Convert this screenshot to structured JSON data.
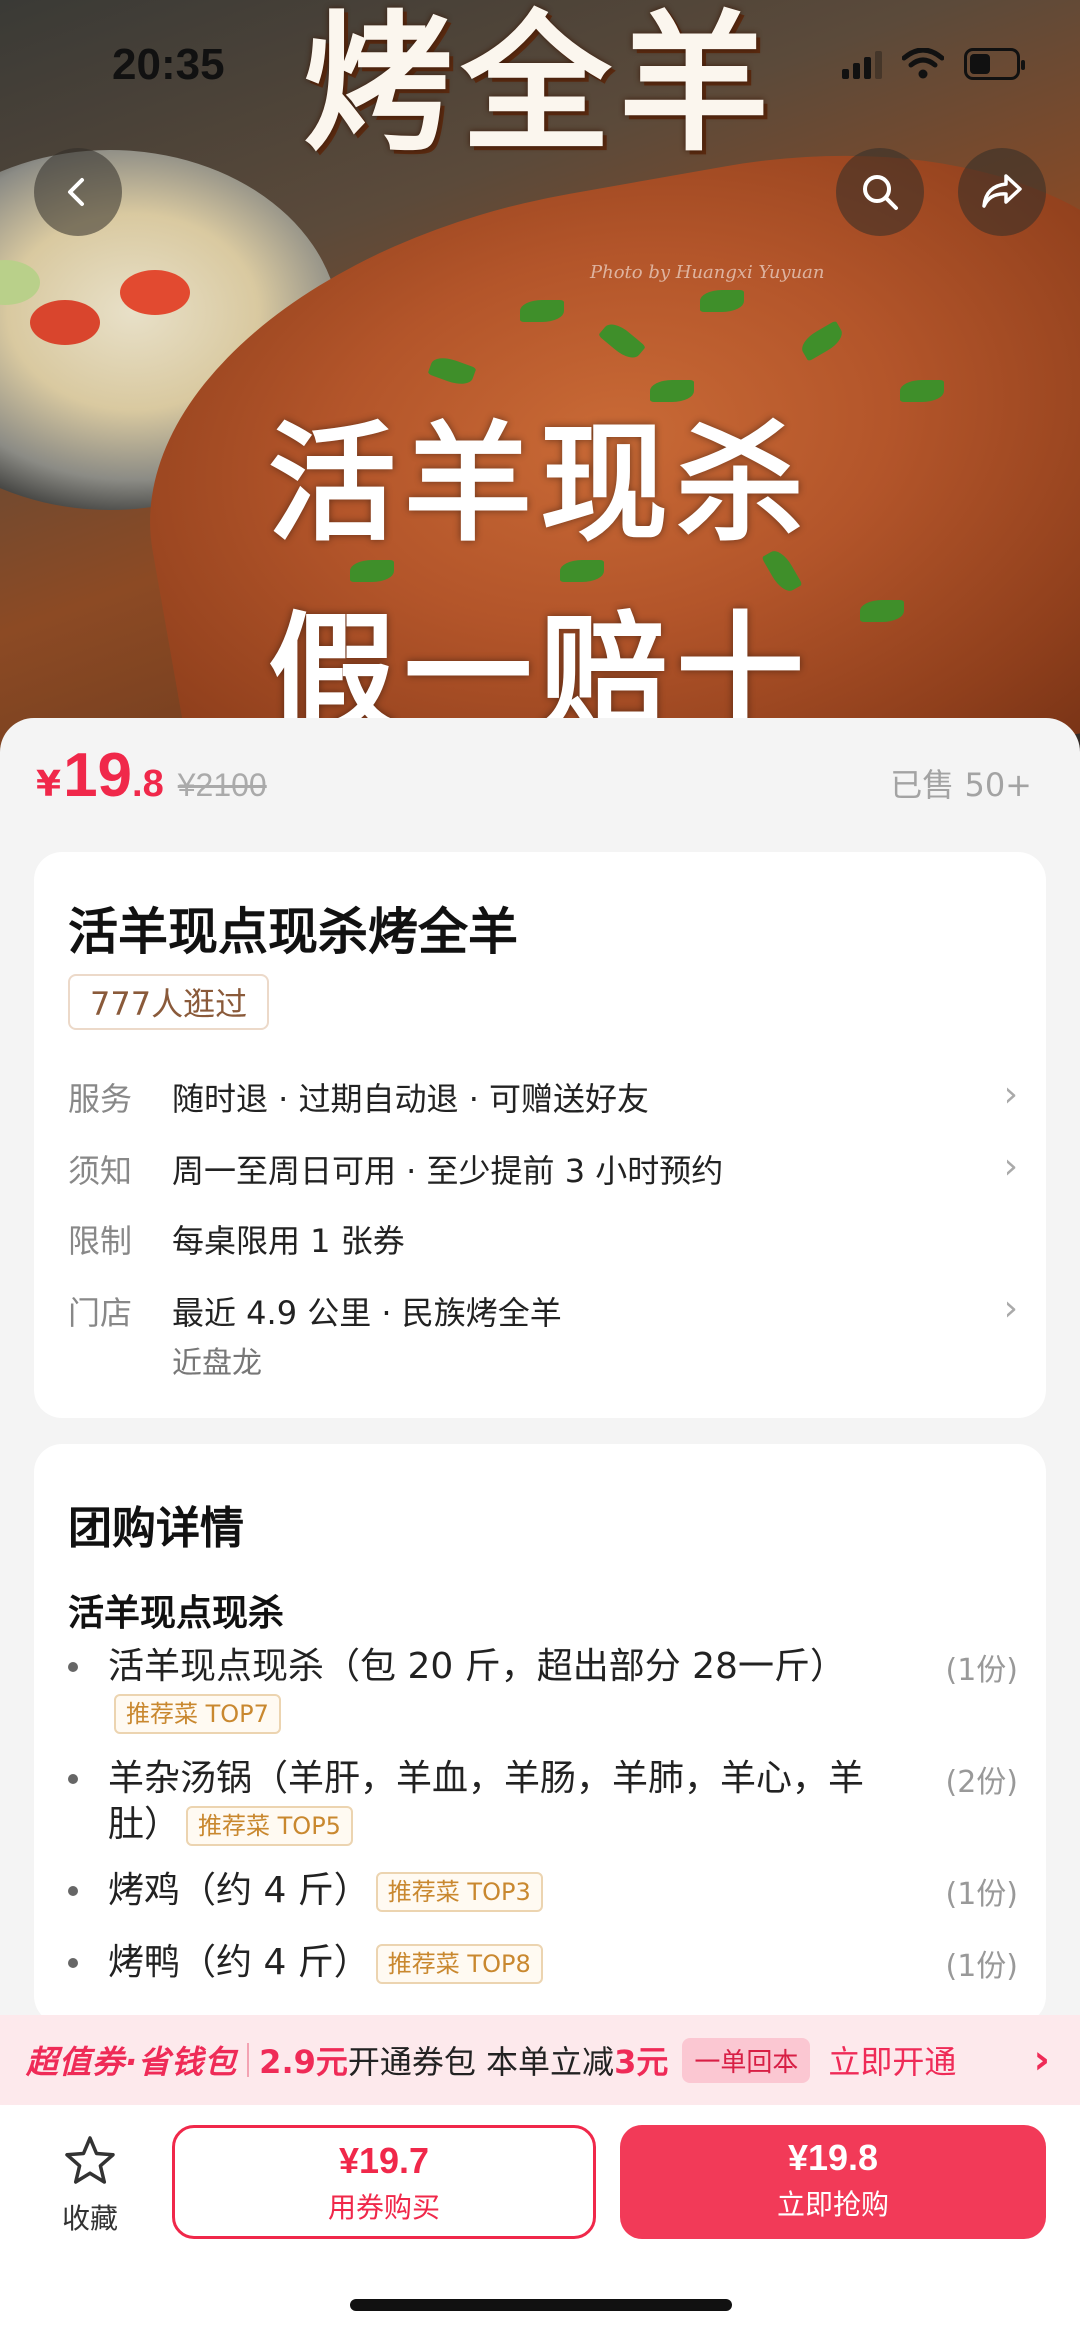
{
  "status_bar": {
    "time": "20:35",
    "battery_label": "34"
  },
  "hero": {
    "title_top": "烤全羊",
    "title_mid": "活羊现杀",
    "title_low": "假一赔十",
    "watermark": "Photo by Huangxi Yuyuan"
  },
  "price": {
    "currency": "¥",
    "integer": "19",
    "decimal": ".8",
    "original": "¥2100",
    "sold": "已售 50+"
  },
  "deal": {
    "title": "活羊现点现杀烤全羊",
    "visits": "777人逛过",
    "rows": [
      {
        "label": "服务",
        "value": "随时退 · 过期自动退 · 可赠送好友",
        "sub": "",
        "has_chevron": true
      },
      {
        "label": "须知",
        "value": "周一至周日可用 · 至少提前 3 小时预约",
        "sub": "",
        "has_chevron": true
      },
      {
        "label": "限制",
        "value": "每桌限用 1 张券",
        "sub": "",
        "has_chevron": false
      },
      {
        "label": "门店",
        "value": "最近 4.9 公里 · 民族烤全羊",
        "sub": "近盘龙",
        "has_chevron": true
      }
    ]
  },
  "details": {
    "section_title": "团购详情",
    "group_title": "活羊现点现杀",
    "items": [
      {
        "text": "活羊现点现杀（包 20 斤，超出部分 28一斤）",
        "tag": "推荐菜 TOP7",
        "qty": "(1份)"
      },
      {
        "text": "羊杂汤锅（羊肝，羊血，羊肠，羊肺，羊心，羊肚）",
        "tag": "推荐菜 TOP5",
        "qty": "(2份)"
      },
      {
        "text": "烤鸡（约 4 斤）",
        "tag": "推荐菜 TOP3",
        "qty": "(1份)"
      },
      {
        "text": "烤鸭（约 4 斤）",
        "tag": "推荐菜 TOP8",
        "qty": "(1份)"
      }
    ]
  },
  "promo": {
    "brand": "超值券·省钱包",
    "amount": "2.9元",
    "text1": "开通券包 本单立减",
    "discount": "3元",
    "pill": "一单回本",
    "cta": "立即开通"
  },
  "bottom_bar": {
    "favorite_label": "收藏",
    "coupon_price": "¥19.7",
    "coupon_label": "用券购买",
    "buy_price": "¥19.8",
    "buy_label": "立即抢购"
  },
  "colors": {
    "accent": "#f0284a",
    "tag_text": "#c9882f",
    "promo_bg": "#fde9ec"
  }
}
